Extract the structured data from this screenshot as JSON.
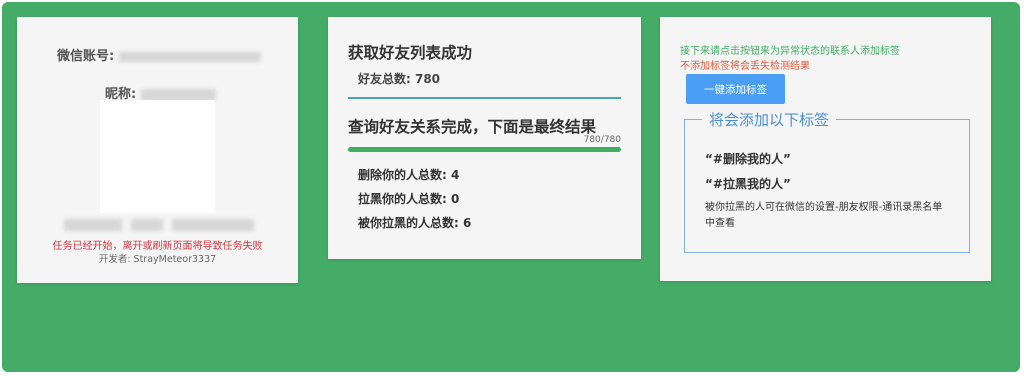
{
  "user_card": {
    "account_label": "微信账号:",
    "nickname_label": "昵称:",
    "warning": "任务已经开始，离开或刷新页面将导致任务失败",
    "author": "开发者: StrayMeteor3337"
  },
  "progress_card": {
    "title": "获取好友列表成功",
    "friend_total": "好友总数: 780",
    "title2": "查询好友关系完成，下面是最终结果",
    "progress_text": "780/780",
    "progress_fraction": 1.0,
    "stats": [
      "删除你的人总数: 4",
      "拉黑你的人总数: 0",
      "被你拉黑的人总数: 6"
    ]
  },
  "tag_card": {
    "info": "接下来请点击按钮来为异常状态的联系人添加标签",
    "warn": "不添加标签将会丢失检测结果",
    "button": "一键添加标签",
    "legend": "将会添加以下标签",
    "tags": [
      "“#删除我的人”",
      "“#拉黑我的人”"
    ],
    "note": "被你拉黑的人可在微信的设置-朋友权限-通讯录黑名单中查看"
  },
  "colors": {
    "background": "#45ac68",
    "accent_green": "#3fae63",
    "button_blue": "#4a9ff5",
    "warning_red": "#d9343e"
  }
}
